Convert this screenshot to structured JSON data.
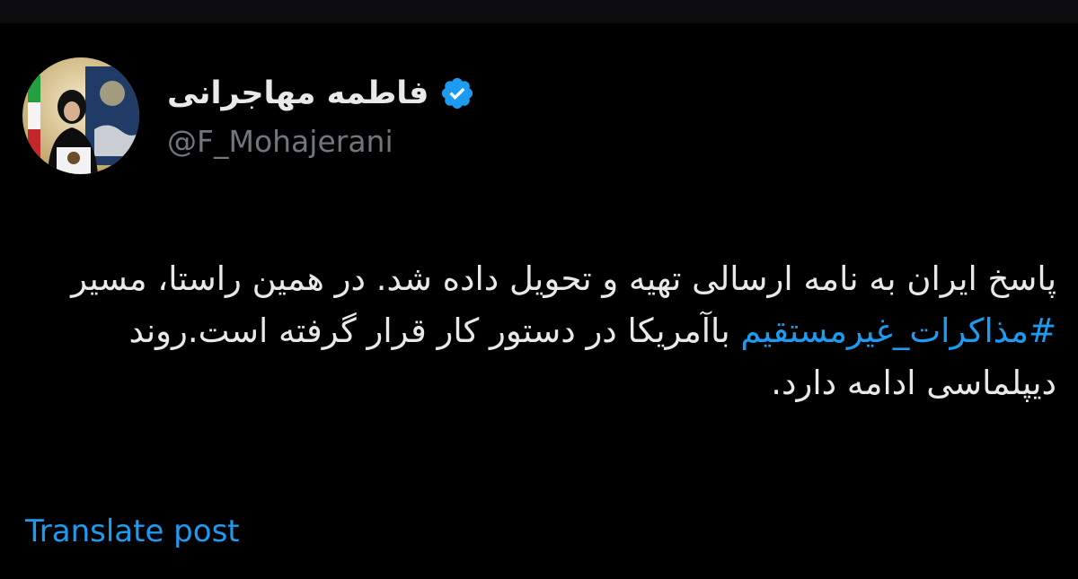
{
  "author": {
    "display_name": "فاطمه مهاجرانی",
    "handle": "@F_Mohajerani",
    "verified_icon": "verified-badge-icon",
    "avatar": "avatar-photo"
  },
  "post": {
    "text_before_hashtag": "پاسخ ایران به نامه ارسالی تهیه و تحویل داده شد. در همین راستا، مسیر ",
    "hashtag": "#مذاکرات_غیرمستقیم",
    "text_after_hashtag": " باآمریکا در دستور کار قرار گرفته است.روند دیپلماسی ادامه دارد."
  },
  "actions": {
    "translate_label": "Translate post"
  },
  "colors": {
    "background": "#000000",
    "text": "#e7e9ea",
    "secondary_text": "#71767b",
    "accent": "#1d9bf0"
  }
}
